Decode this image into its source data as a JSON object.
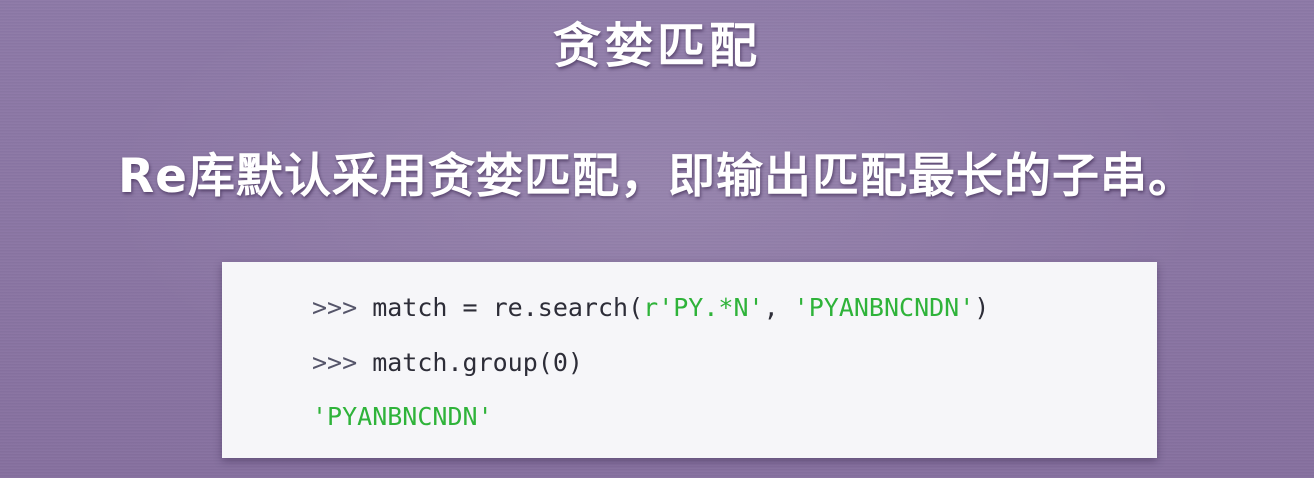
{
  "slide": {
    "title": "贪婪匹配",
    "subtitle": "Re库默认采用贪婪匹配，即输出匹配最长的子串。"
  },
  "code": {
    "line1": {
      "prompt": ">>>",
      "pre": " match = re.search(",
      "pattern": "r'PY.*N'",
      "sep": ", ",
      "target": "'PYANBNCNDN'",
      "post": ")"
    },
    "line2": {
      "prompt": ">>>",
      "code": " match.group(0)"
    },
    "line3": {
      "output": "'PYANBNCNDN'"
    }
  },
  "colors": {
    "background": "#8a76a4",
    "code_background": "#f6f6f9",
    "string_green": "#2fb33a",
    "code_text": "#2d2d38"
  }
}
